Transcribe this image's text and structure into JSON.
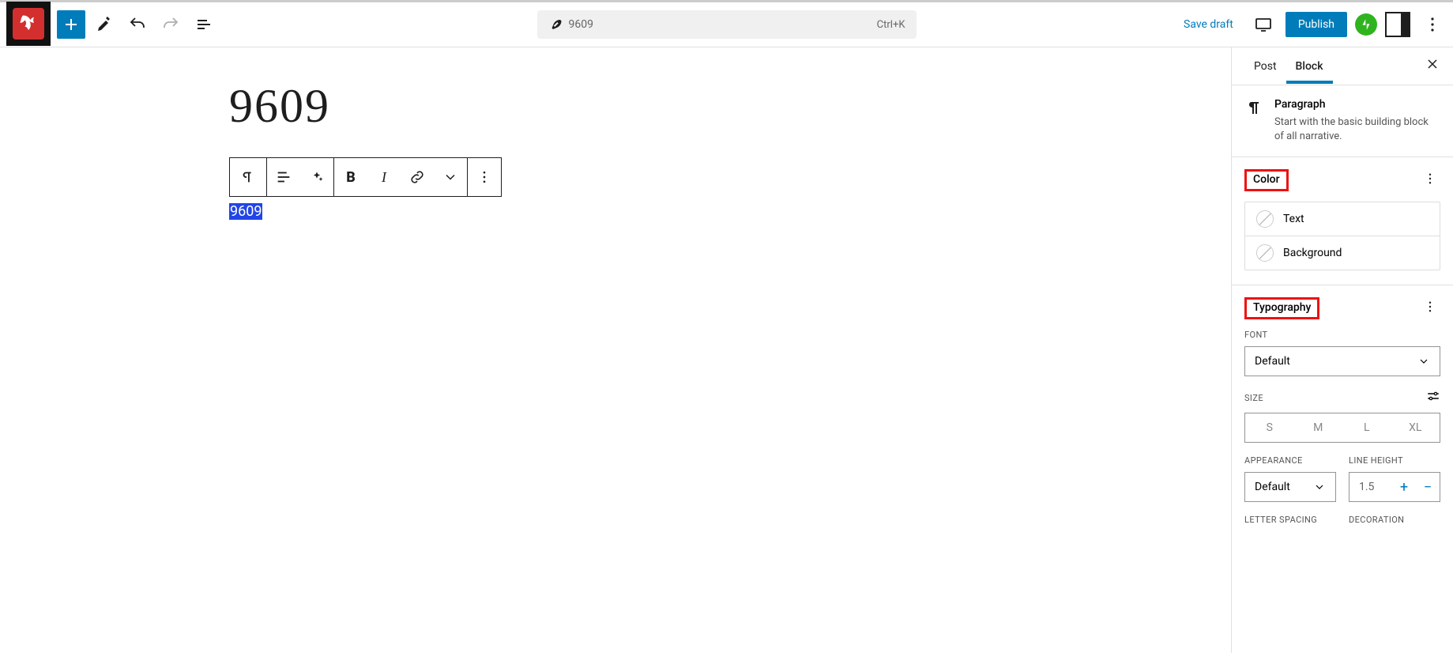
{
  "header": {
    "doc_title": "9609",
    "shortcut": "Ctrl+K",
    "save_draft": "Save draft",
    "publish": "Publish"
  },
  "editor": {
    "post_title": "9609",
    "selected_text": "9609"
  },
  "sidebar": {
    "tabs": {
      "post": "Post",
      "block": "Block"
    },
    "block_info": {
      "title": "Paragraph",
      "desc": "Start with the basic building block of all narrative."
    },
    "color": {
      "title": "Color",
      "text": "Text",
      "background": "Background"
    },
    "typography": {
      "title": "Typography",
      "font_label": "FONT",
      "font_value": "Default",
      "size_label": "SIZE",
      "sizes": {
        "s": "S",
        "m": "M",
        "l": "L",
        "xl": "XL"
      },
      "appearance_label": "APPEARANCE",
      "appearance_value": "Default",
      "lineheight_label": "LINE HEIGHT",
      "lineheight_value": "1.5",
      "letter_spacing_label": "LETTER SPACING",
      "decoration_label": "DECORATION"
    }
  }
}
